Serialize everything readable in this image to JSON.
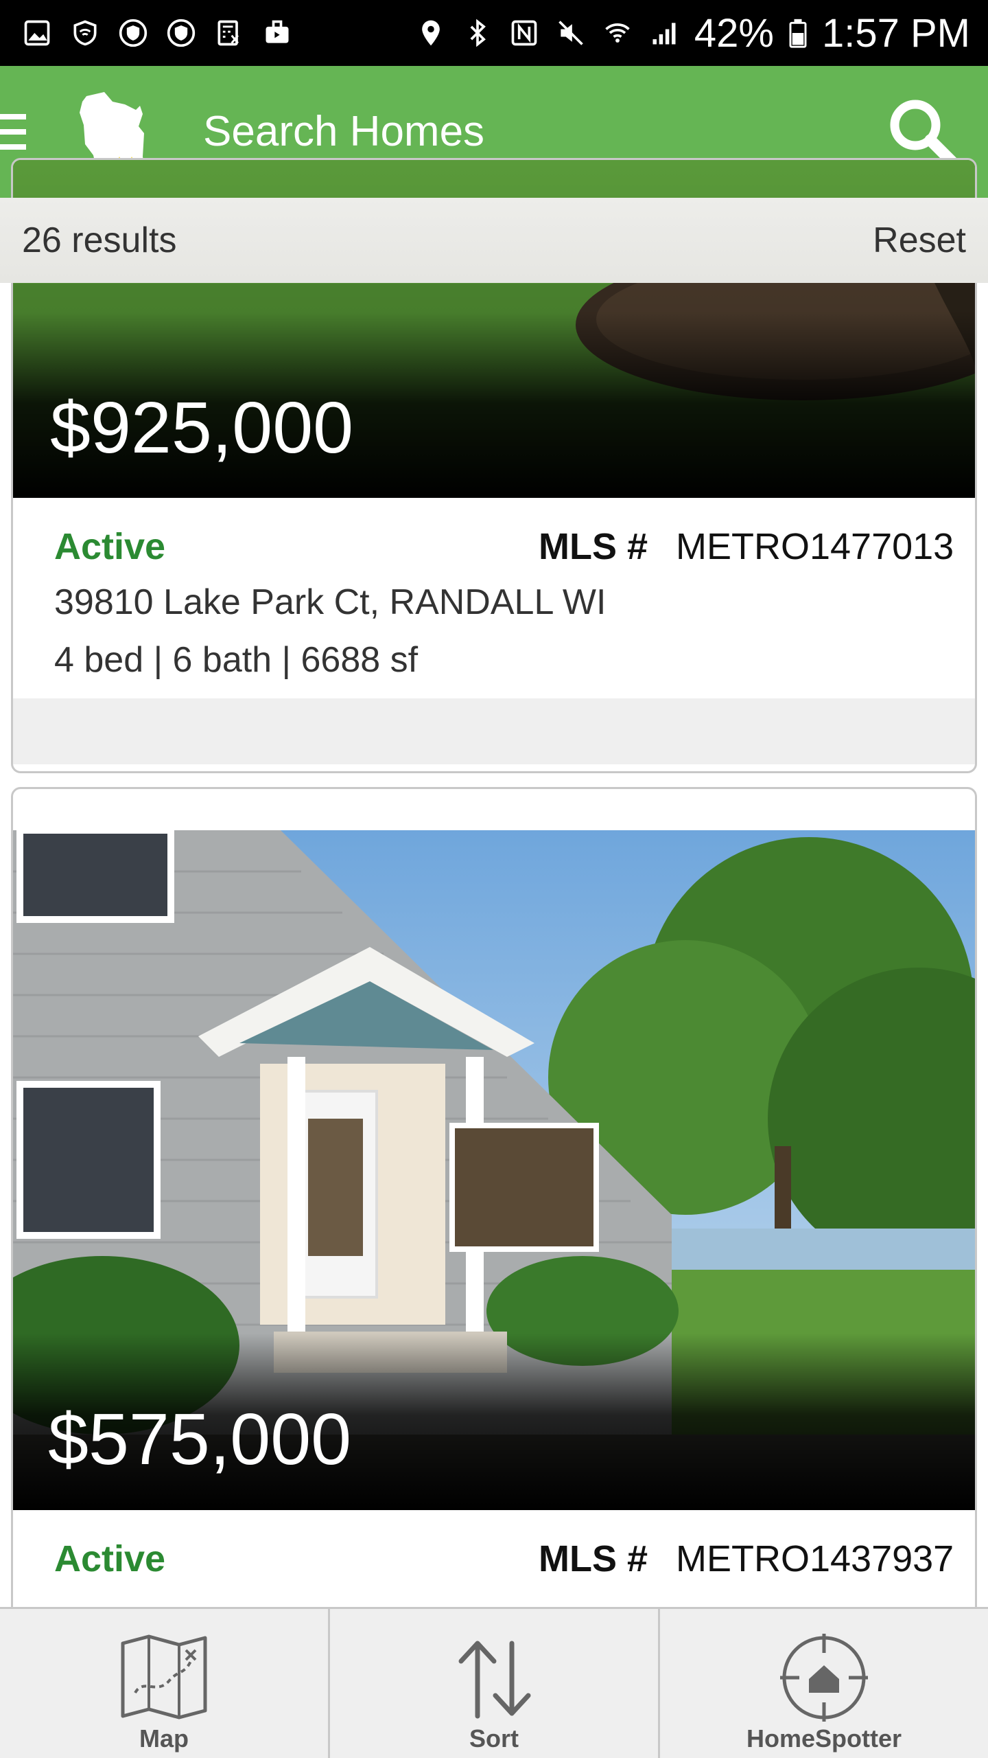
{
  "status_bar": {
    "battery": "42%",
    "time": "1:57 PM"
  },
  "app_bar": {
    "title": "Search Homes"
  },
  "results_bar": {
    "count": "26 results",
    "reset": "Reset"
  },
  "listings": [
    {
      "price": "$925,000",
      "status": "Active",
      "mls_label": "MLS #",
      "mls": "METRO1477013",
      "address": "39810 Lake Park Ct, RANDALL WI",
      "specs": "4 bed | 6 bath | 6688 sf"
    },
    {
      "price": "$575,000",
      "status": "Active",
      "mls_label": "MLS #",
      "mls": "METRO1437937"
    }
  ],
  "bottom_nav": {
    "items": [
      {
        "label": "Map",
        "icon": "map-icon"
      },
      {
        "label": "Sort",
        "icon": "sort-icon"
      },
      {
        "label": "HomeSpotter",
        "icon": "homespotter-icon"
      }
    ]
  },
  "colors": {
    "app_bar": "#65b554",
    "active_status": "#2b8a32"
  }
}
